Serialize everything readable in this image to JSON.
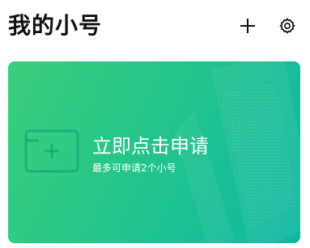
{
  "header": {
    "title": "我的小号",
    "add_icon": "plus-icon",
    "settings_icon": "gear-icon"
  },
  "card": {
    "title": "立即点击申请",
    "subtitle": "最多可申请2个小号",
    "icon": "add-card-icon",
    "gradient_start": "#3ccf7d",
    "gradient_end": "#0fb7a2"
  }
}
